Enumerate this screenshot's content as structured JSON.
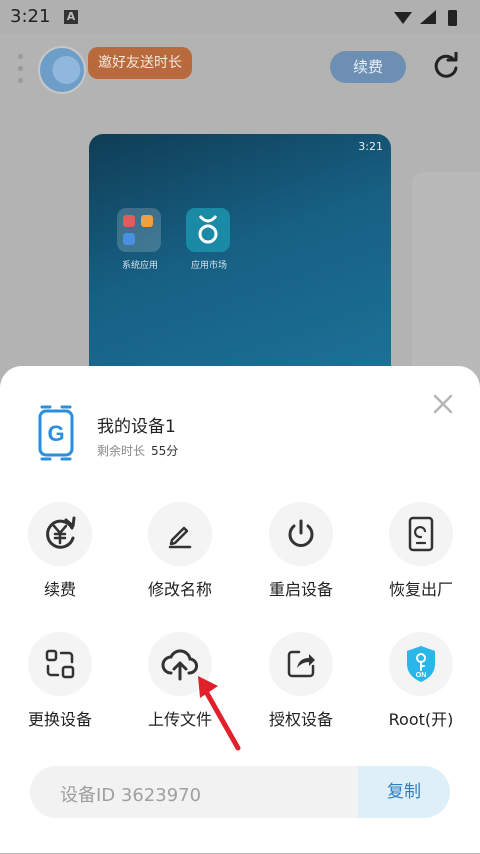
{
  "status_bar": {
    "time": "3:21",
    "notification_icon": "A"
  },
  "header": {
    "invite_label": "邀好友送时长",
    "renew_label": "续费",
    "refresh_icon": "refresh-icon"
  },
  "phone_preview": {
    "status_time": "3:21",
    "apps": [
      {
        "label": "系统应用"
      },
      {
        "label": "应用市场"
      }
    ]
  },
  "sheet": {
    "device_name": "我的设备1",
    "remaining_label": "剩余时长",
    "remaining_value": "55分",
    "actions": [
      {
        "label": "续费",
        "icon": "yen-refresh-icon"
      },
      {
        "label": "修改名称",
        "icon": "pencil-icon"
      },
      {
        "label": "重启设备",
        "icon": "power-icon"
      },
      {
        "label": "恢复出厂",
        "icon": "phone-reset-icon"
      },
      {
        "label": "更换设备",
        "icon": "swap-device-icon"
      },
      {
        "label": "上传文件",
        "icon": "cloud-upload-icon"
      },
      {
        "label": "授权设备",
        "icon": "share-icon"
      },
      {
        "label": "Root(开)",
        "icon": "root-shield-icon",
        "badge": "ON"
      }
    ],
    "device_id": "设备ID 3623970",
    "copy_label": "复制"
  },
  "colors": {
    "accent": "#2c7fc0",
    "root_shield": "#29b6e8",
    "arrow": "#e0202a"
  }
}
